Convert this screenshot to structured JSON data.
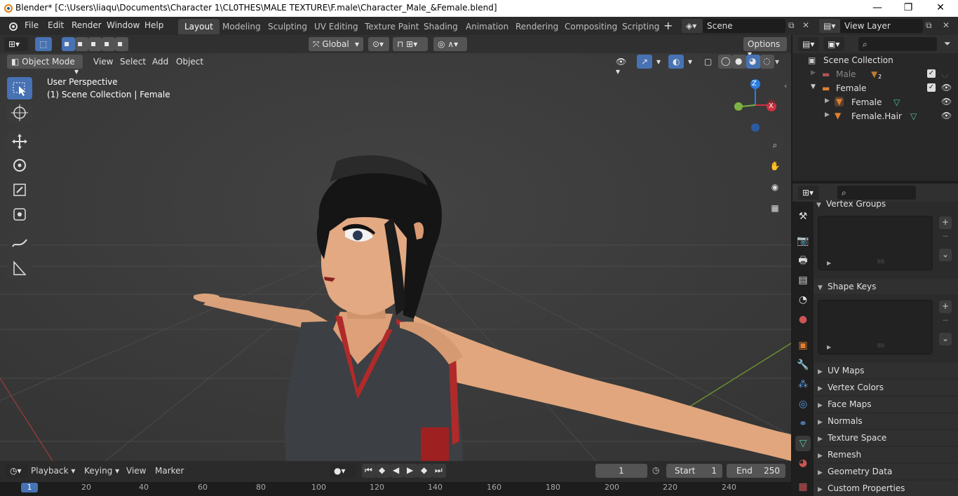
{
  "titlebar": {
    "title": "Blender* [C:\\Users\\liaqu\\Documents\\Character 1\\CL0THES\\MALE TEXTURE\\F.male\\Character_Male_&Female.blend]",
    "minimize": "—",
    "maximize": "❐",
    "close": "✕"
  },
  "menubar": {
    "items": [
      "File",
      "Edit",
      "Render",
      "Window",
      "Help"
    ],
    "workspaces": [
      "Layout",
      "Modeling",
      "Sculpting",
      "UV Editing",
      "Texture Paint",
      "Shading",
      "Animation",
      "Rendering",
      "Compositing",
      "Scripting"
    ],
    "active_workspace": "Layout",
    "add_tab": "+",
    "scene": "Scene",
    "view_layer": "View Layer"
  },
  "viewport_header": {
    "transform_orientation": "Global",
    "options": "Options",
    "mode": "Object Mode",
    "menus": [
      "View",
      "Select",
      "Add",
      "Object"
    ]
  },
  "viewport": {
    "overlay_line1": "User Perspective",
    "overlay_line2": "(1) Scene Collection | Female",
    "gizmo_z": "Z",
    "gizmo_x": "X"
  },
  "outliner": {
    "root": "Scene Collection",
    "items": [
      {
        "name": "Male",
        "badge": "2"
      },
      {
        "name": "Female"
      },
      {
        "name": "Female"
      },
      {
        "name": "Female.Hair"
      }
    ]
  },
  "properties": {
    "panels": [
      {
        "label": "Vertex Groups"
      },
      {
        "label": "Shape Keys"
      },
      {
        "label": "UV Maps"
      },
      {
        "label": "Vertex Colors"
      },
      {
        "label": "Face Maps"
      },
      {
        "label": "Normals"
      },
      {
        "label": "Texture Space"
      },
      {
        "label": "Remesh"
      },
      {
        "label": "Geometry Data"
      },
      {
        "label": "Custom Properties"
      }
    ]
  },
  "timeline": {
    "menus": [
      "Playback",
      "Keying",
      "View",
      "Marker"
    ],
    "current_frame": "1",
    "start_label": "Start",
    "start_value": "1",
    "end_label": "End",
    "end_value": "250",
    "ruler": [
      "1",
      "20",
      "40",
      "60",
      "80",
      "100",
      "120",
      "140",
      "160",
      "180",
      "200",
      "220",
      "240"
    ]
  },
  "colors": {
    "accent": "#4772b3",
    "active_tab": "#434343",
    "viewport_bg": "#3d3d3d",
    "skin": "#e0a27a",
    "top": "#3c3f44",
    "trim": "#b12a2a",
    "hair": "#141414"
  }
}
